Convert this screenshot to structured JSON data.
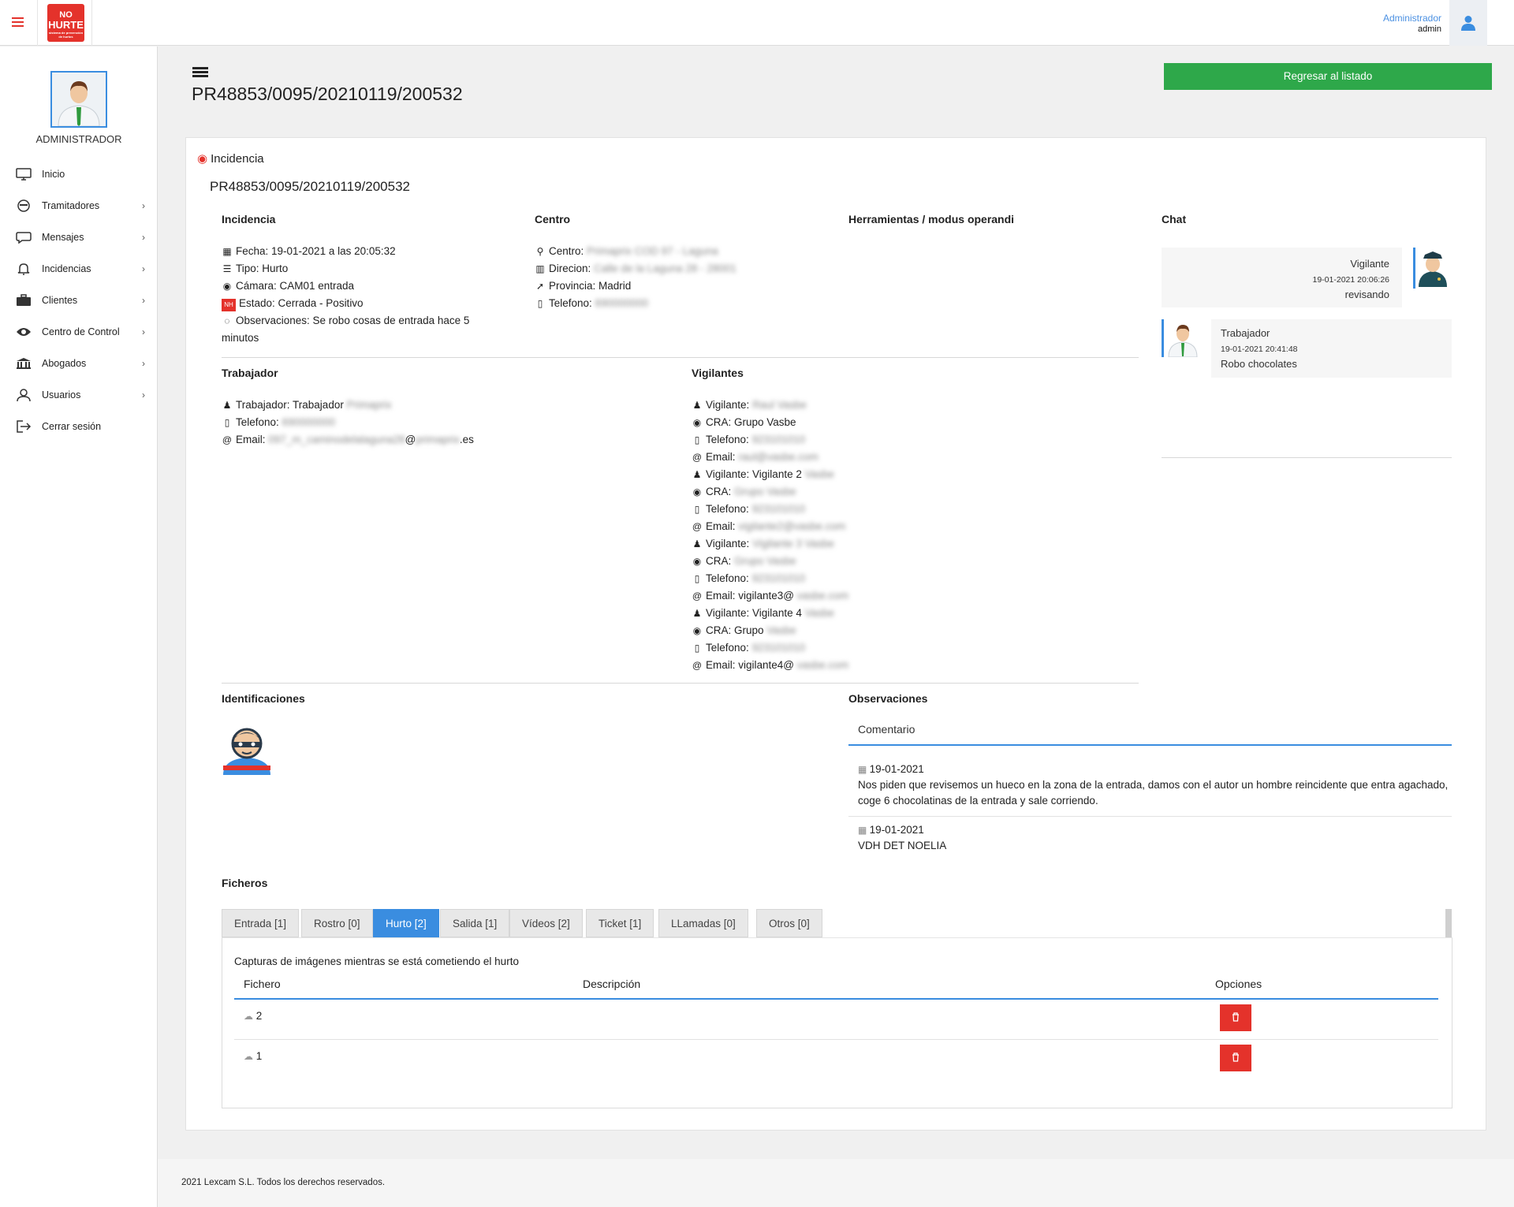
{
  "topbar": {
    "logo_line1": "NO",
    "logo_line2": "HURTE",
    "logo_line3": "sistema de prevención de hurtos",
    "user_role": "Administrador",
    "user_name": "admin"
  },
  "sidebar": {
    "role": "ADMINISTRADOR",
    "items": [
      {
        "label": "Inicio",
        "icon": "monitor-icon",
        "chevron": ""
      },
      {
        "label": "Tramitadores",
        "icon": "mask-icon",
        "chevron": "›"
      },
      {
        "label": "Mensajes",
        "icon": "chat-bubble-icon",
        "chevron": "›"
      },
      {
        "label": "Incidencias",
        "icon": "bell-icon",
        "chevron": "›"
      },
      {
        "label": "Clientes",
        "icon": "briefcase-icon",
        "chevron": "›"
      },
      {
        "label": "Centro de Control",
        "icon": "eye-icon",
        "chevron": "›"
      },
      {
        "label": "Abogados",
        "icon": "bank-icon",
        "chevron": "›"
      },
      {
        "label": "Usuarios",
        "icon": "user-icon",
        "chevron": "›"
      },
      {
        "label": "Cerrar sesión",
        "icon": "logout-icon",
        "chevron": ""
      }
    ]
  },
  "header": {
    "title": "PR48853/0095/20210119/200532",
    "back_button": "Regresar al listado"
  },
  "card": {
    "title": "Incidencia",
    "code": "PR48853/0095/20210119/200532"
  },
  "incidencia": {
    "heading": "Incidencia",
    "fecha": "Fecha: 19-01-2021 a las 20:05:32",
    "tipo": "Tipo: Hurto",
    "camara": "Cámara: CAM01 entrada",
    "estado": "Estado: Cerrada - Positivo",
    "obs1": "Observaciones: Se robo cosas de entrada hace 5",
    "obs2": "minutos"
  },
  "centro": {
    "heading": "Centro",
    "centro_label": "Centro:",
    "centro_value": "Primaprix COD 97 - Laguna",
    "direccion_label": "Direcion:",
    "direccion_value": "Calle de la Laguna 28 - 28001",
    "provincia": "Provincia: Madrid",
    "telefono_label": "Telefono:",
    "telefono_value": "690000000"
  },
  "herramientas": {
    "heading": "Herramientas / modus operandi"
  },
  "trabajador": {
    "heading": "Trabajador",
    "trabajador_label": "Trabajador: Trabajador",
    "trabajador_blur": "Primaprix",
    "telefono_label": "Telefono:",
    "telefono_value": "690000000",
    "email_label": "Email:",
    "email_blur1": "097_m_caminodelalaguna28",
    "email_at": "@",
    "email_blur2": "primaprix",
    "email_end": ".es"
  },
  "vigilantes": {
    "heading": "Vigilantes",
    "rows": [
      {
        "icon": "user-icon",
        "label": "Vigilante:",
        "clear": "",
        "blur": "Raul Vasbe"
      },
      {
        "icon": "eye-icon",
        "label": "CRA: Grupo Vasbe",
        "clear": "",
        "blur": ""
      },
      {
        "icon": "phone-icon",
        "label": "Telefono:",
        "clear": "",
        "blur": "923101010"
      },
      {
        "icon": "at-icon",
        "label": "Email:",
        "clear": "",
        "blur": "raul@vasbe.com"
      },
      {
        "icon": "user-icon",
        "label": "Vigilante: Vigilante 2",
        "clear": "",
        "blur": "Vasbe"
      },
      {
        "icon": "eye-icon",
        "label": "CRA:",
        "clear": "",
        "blur": "Grupo Vasbe"
      },
      {
        "icon": "phone-icon",
        "label": "Telefono:",
        "clear": "",
        "blur": "923101010"
      },
      {
        "icon": "at-icon",
        "label": "Email:",
        "clear": "",
        "blur": "vigilante2@vasbe.com"
      },
      {
        "icon": "user-icon",
        "label": "Vigilante:",
        "clear": "",
        "blur": "Vigilante 3 Vasbe"
      },
      {
        "icon": "eye-icon",
        "label": "CRA:",
        "clear": "",
        "blur": "Grupo Vasbe"
      },
      {
        "icon": "phone-icon",
        "label": "Telefono:",
        "clear": "",
        "blur": "923101010"
      },
      {
        "icon": "at-icon",
        "label": "Email: vigilante3@",
        "clear": "",
        "blur": "vasbe.com"
      },
      {
        "icon": "user-icon",
        "label": "Vigilante: Vigilante 4",
        "clear": "",
        "blur": "Vasbe"
      },
      {
        "icon": "eye-icon",
        "label": "CRA: Grupo",
        "clear": "",
        "blur": "Vasbe"
      },
      {
        "icon": "phone-icon",
        "label": "Telefono:",
        "clear": "",
        "blur": "923101010"
      },
      {
        "icon": "at-icon",
        "label": "Email: vigilante4@",
        "clear": "",
        "blur": "vasbe.com"
      }
    ]
  },
  "chat": {
    "heading": "Chat",
    "msg1": {
      "name": "Vigilante",
      "date": "19-01-2021 20:06:26",
      "text": "revisando"
    },
    "msg2": {
      "name": "Trabajador",
      "date": "19-01-2021 20:41:48",
      "text": "Robo chocolates"
    }
  },
  "identificaciones": {
    "heading": "Identificaciones"
  },
  "observaciones": {
    "heading": "Observaciones",
    "column": "Comentario",
    "items": [
      {
        "date": "19-01-2021",
        "text": "Nos piden que revisemos un hueco en la zona de la entrada, damos con el autor un hombre reincidente que entra agachado, coge 6 chocolatinas de la entrada y sale corriendo."
      },
      {
        "date": "19-01-2021",
        "text": "VDH DET NOELIA"
      }
    ]
  },
  "ficheros": {
    "heading": "Ficheros",
    "tabs": [
      "Entrada [1]",
      "Rostro [0]",
      "Hurto [2]",
      "Salida [1]",
      "Vídeos [2]",
      "Ticket [1]",
      "LLamadas [0]",
      "Otros [0]"
    ],
    "active_tab": "Hurto [2]",
    "description": "Capturas de imágenes mientras se está cometiendo el hurto",
    "columns": [
      "Fichero",
      "Descripción",
      "Opciones"
    ],
    "rows": [
      {
        "fichero": "2",
        "descripcion": ""
      },
      {
        "fichero": "1",
        "descripcion": ""
      }
    ]
  },
  "footer": {
    "text": "2021 Lexcam S.L. Todos los derechos reservados."
  },
  "colors": {
    "accent": "#3a8de0",
    "brand_red": "#e4322b",
    "success": "#2ea84a"
  }
}
